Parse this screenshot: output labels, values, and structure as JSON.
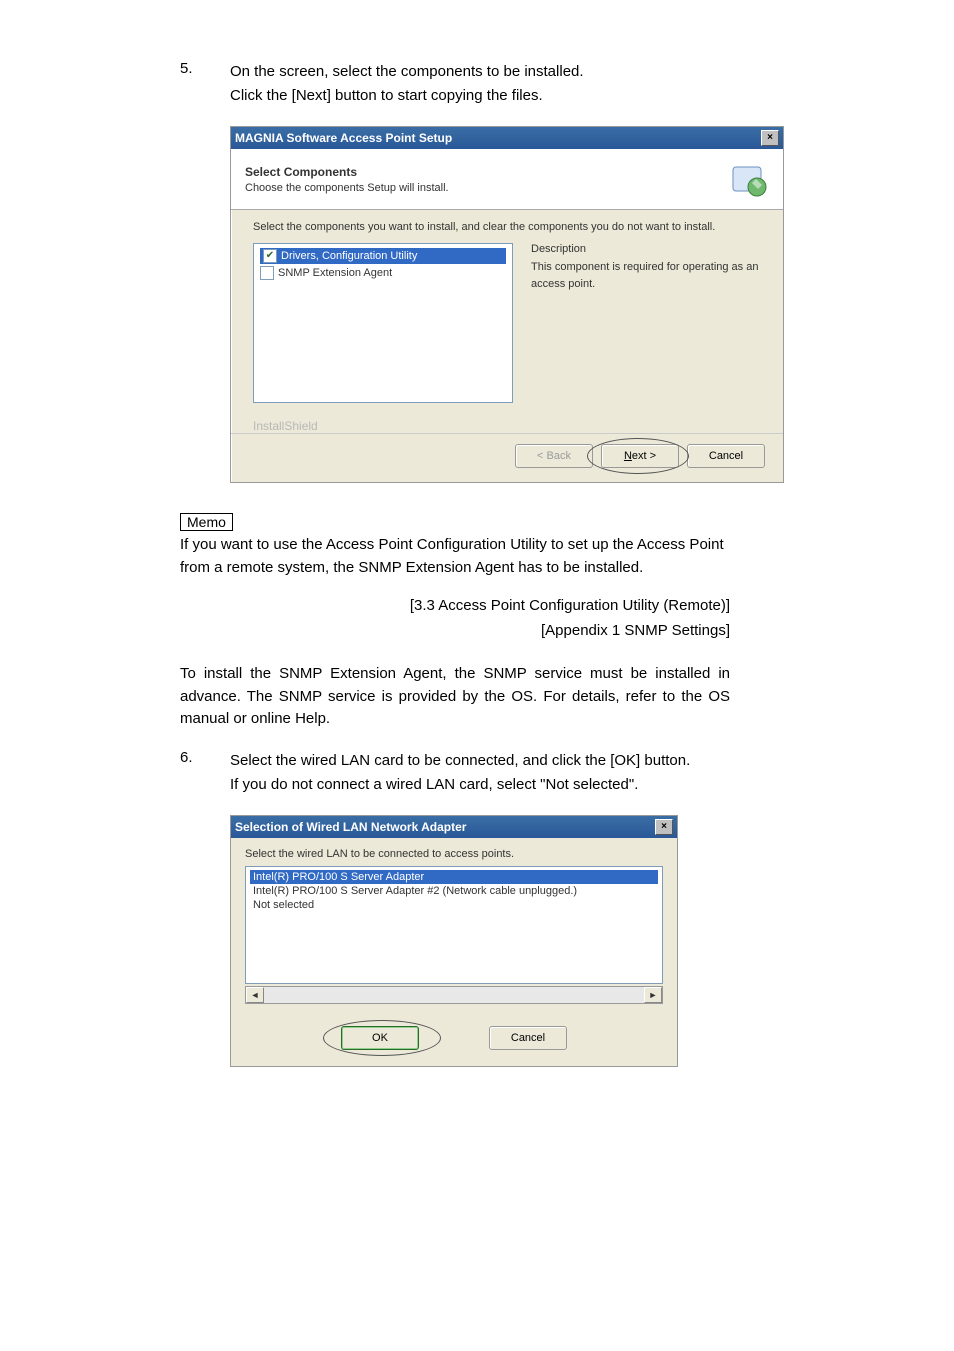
{
  "step5": {
    "num": "5.",
    "line1": "On the screen, select the components to be installed.",
    "line2": "Click the [Next] button to start copying the files."
  },
  "dialog1": {
    "title": "MAGNIA Software Access Point Setup",
    "header_bold": "Select Components",
    "header_sub": "Choose the components Setup will install.",
    "instruction": "Select the components you want to install, and clear the components you do not want to install.",
    "comp1": "Drivers, Configuration Utility",
    "comp2": "SNMP Extension Agent",
    "desc_label": "Description",
    "desc_text": "This component is required for operating as an access point.",
    "brand": "InstallShield",
    "back": "< Back",
    "next": "Next >",
    "cancel": "Cancel"
  },
  "memo_label": "Memo",
  "memo_para": "If you want to use the Access Point Configuration Utility to set up the Access Point from a remote system, the SNMP Extension Agent has to be installed.",
  "ref1": "[3.3  Access Point Configuration Utility (Remote)]",
  "ref2": "[Appendix 1  SNMP Settings]",
  "snmp_para": "To install the SNMP Extension Agent, the SNMP service must be installed in advance.  The SNMP service is provided by the OS.  For details, refer to the OS manual or online Help.",
  "step6": {
    "num": "6.",
    "line1": "Select the wired LAN card to be connected, and click the [OK] button.",
    "line2": "If you do not connect a wired LAN card, select \"Not selected\"."
  },
  "dialog2": {
    "title": "Selection of Wired LAN Network Adapter",
    "instruction": "Select the wired LAN to be connected to access points.",
    "opt1": "Intel(R) PRO/100 S Server Adapter",
    "opt2": "Intel(R) PRO/100 S Server Adapter #2 (Network cable unplugged.)",
    "opt3": "Not selected",
    "ok": "OK",
    "cancel": "Cancel"
  }
}
